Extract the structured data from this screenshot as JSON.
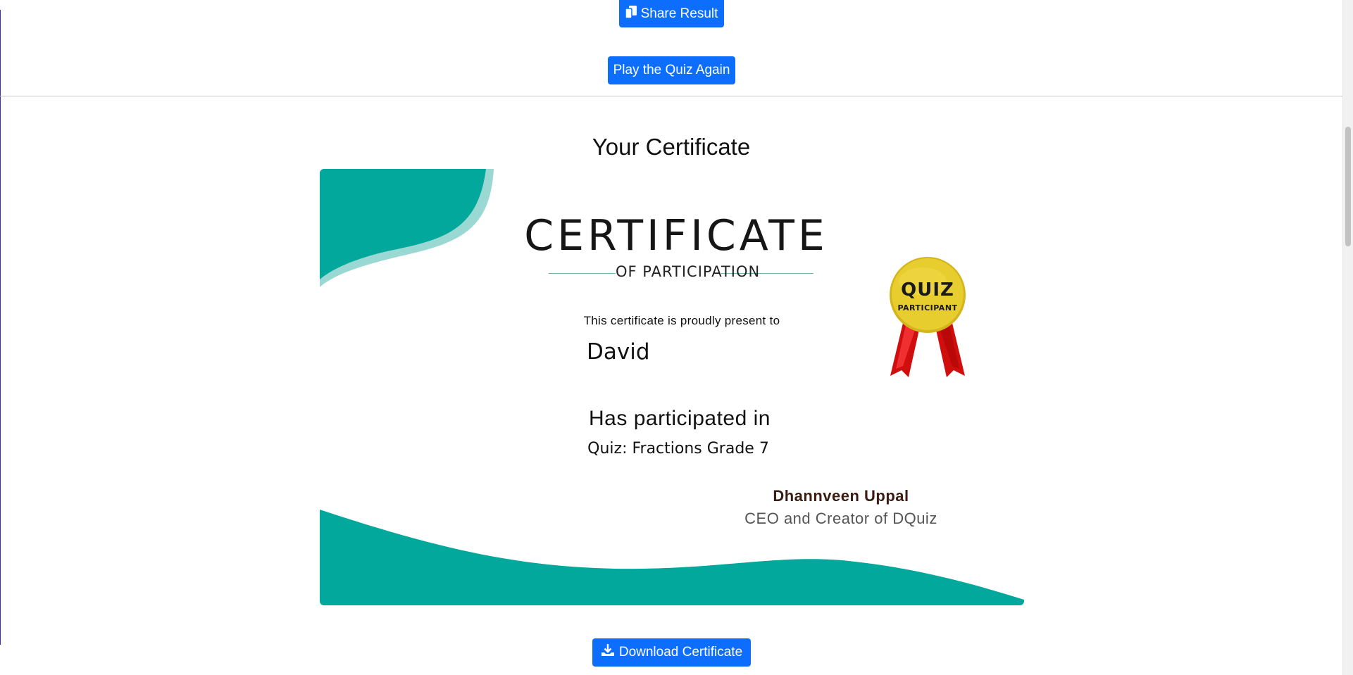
{
  "actions": {
    "share_label": "Share Result",
    "play_again_label": "Play the Quiz Again",
    "download_label": "Download Certificate"
  },
  "section": {
    "title": "Your Certificate"
  },
  "certificate": {
    "heading": "CERTIFICATE",
    "subheading": "OF PARTICIPATION",
    "present_text": "This certificate is proudly present to",
    "recipient_name": "David",
    "participated_text": "Has participated in",
    "quiz_name": "Quiz: Fractions Grade 7",
    "signer_name": "Dhannveen Uppal",
    "signer_role": "CEO and Creator of DQuiz",
    "badge": {
      "line1": "QUIZ",
      "line2": "PARTICIPANT"
    }
  },
  "icons": {
    "share": "copy-icon",
    "download": "download-icon"
  },
  "colors": {
    "primary_button": "#0d6efd",
    "teal": "#02a89b",
    "teal_light": "#9ad9d3",
    "badge_gold": "#e8cd2e",
    "ribbon_red": "#d10e0e"
  }
}
